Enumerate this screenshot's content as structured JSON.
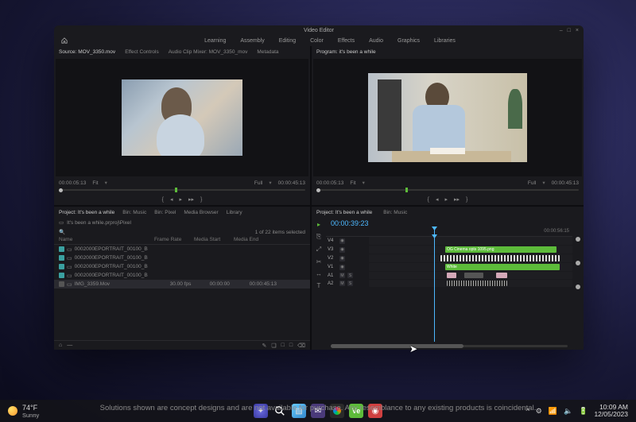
{
  "window": {
    "title": "Video Editor",
    "minimize": "–",
    "maximize": "□",
    "close": "×"
  },
  "menubar": {
    "items": [
      "Learning",
      "Assembly",
      "Editing",
      "Color",
      "Effects",
      "Audio",
      "Graphics",
      "Libraries"
    ]
  },
  "source_panel": {
    "tabs": [
      "Source: MOV_3350.mov",
      "Effect Controls",
      "Audio Clip Mixer: MOV_3350_mov",
      "Metadata"
    ],
    "tc_left": "00:00:05:13",
    "fit_label": "Fit",
    "full_label": "Full",
    "tc_right": "00:00:45:13"
  },
  "program_panel": {
    "tab": "Program: it's been a while",
    "tc_left": "00:00:05:13",
    "fit_label": "Fit",
    "full_label": "Full",
    "tc_right": "00:00:45:13"
  },
  "playback_icons": {
    "in": "{",
    "step_back": "◂",
    "play": "▸",
    "step_fwd": "▸▸",
    "out": "}"
  },
  "project_panel": {
    "tabs": [
      "Project: It's been a while",
      "Bin: Music",
      "Bin: Pixel",
      "Media Browser",
      "Library"
    ],
    "path": "It's been a while.prproj\\Pixel",
    "selection": "1 of 22 items selected",
    "columns": {
      "name": "Name",
      "frame_rate": "Frame Rate",
      "media_start": "Media Start",
      "media_end": "Media End"
    },
    "rows": [
      {
        "color": "#3aa0a0",
        "name": "0002000EPORTRAIT_00100_B",
        "fr": "",
        "ms": "",
        "me": ""
      },
      {
        "color": "#3aa0a0",
        "name": "0002000EPORTRAIT_00100_B",
        "fr": "",
        "ms": "",
        "me": ""
      },
      {
        "color": "#3aa0a0",
        "name": "0002000EPORTRAIT_00100_B",
        "fr": "",
        "ms": "",
        "me": ""
      },
      {
        "color": "#3aa0a0",
        "name": "0002000EPORTRAIT_00100_B",
        "fr": "",
        "ms": "",
        "me": ""
      },
      {
        "color": "#555",
        "name": "IMG_3359.Mov",
        "fr": "30.00 fps",
        "ms": "00:00:00",
        "me": "00:00:45:13",
        "selected": true
      }
    ],
    "toolbar_icons": [
      "⌂",
      "—",
      "✎",
      "❏",
      "□",
      "□",
      "⌫"
    ]
  },
  "timeline_panel": {
    "header": {
      "project": "Project: It's been a while",
      "bin": "Bin: Music"
    },
    "tool_icons": [
      "▸",
      "⎘",
      "⤢",
      "✂",
      "↔",
      "T"
    ],
    "timecode": "00:00:39:23",
    "ruler_end": "00:00:56:15",
    "tracks": {
      "v4": "V4",
      "v3": "V3",
      "v2": "V2",
      "v1": "V1",
      "a1": "A1",
      "a2": "A2",
      "toggles": [
        "M",
        "S"
      ],
      "clip_label_v3": "OG Cinema opts 1095.png",
      "clip_label_v1": "White"
    }
  },
  "taskbar": {
    "weather": {
      "temp": "74°F",
      "cond": "Sunny"
    },
    "tray_icons": [
      "^",
      "⚙",
      "⋮⋮",
      "📶",
      "🔈",
      "🔋"
    ],
    "time": "10:09 AM",
    "date": "12/05/2023"
  },
  "disclaimer": "Solutions shown are concept designs and are not available for purchase. Any resemblance to any existing products is coincidental."
}
